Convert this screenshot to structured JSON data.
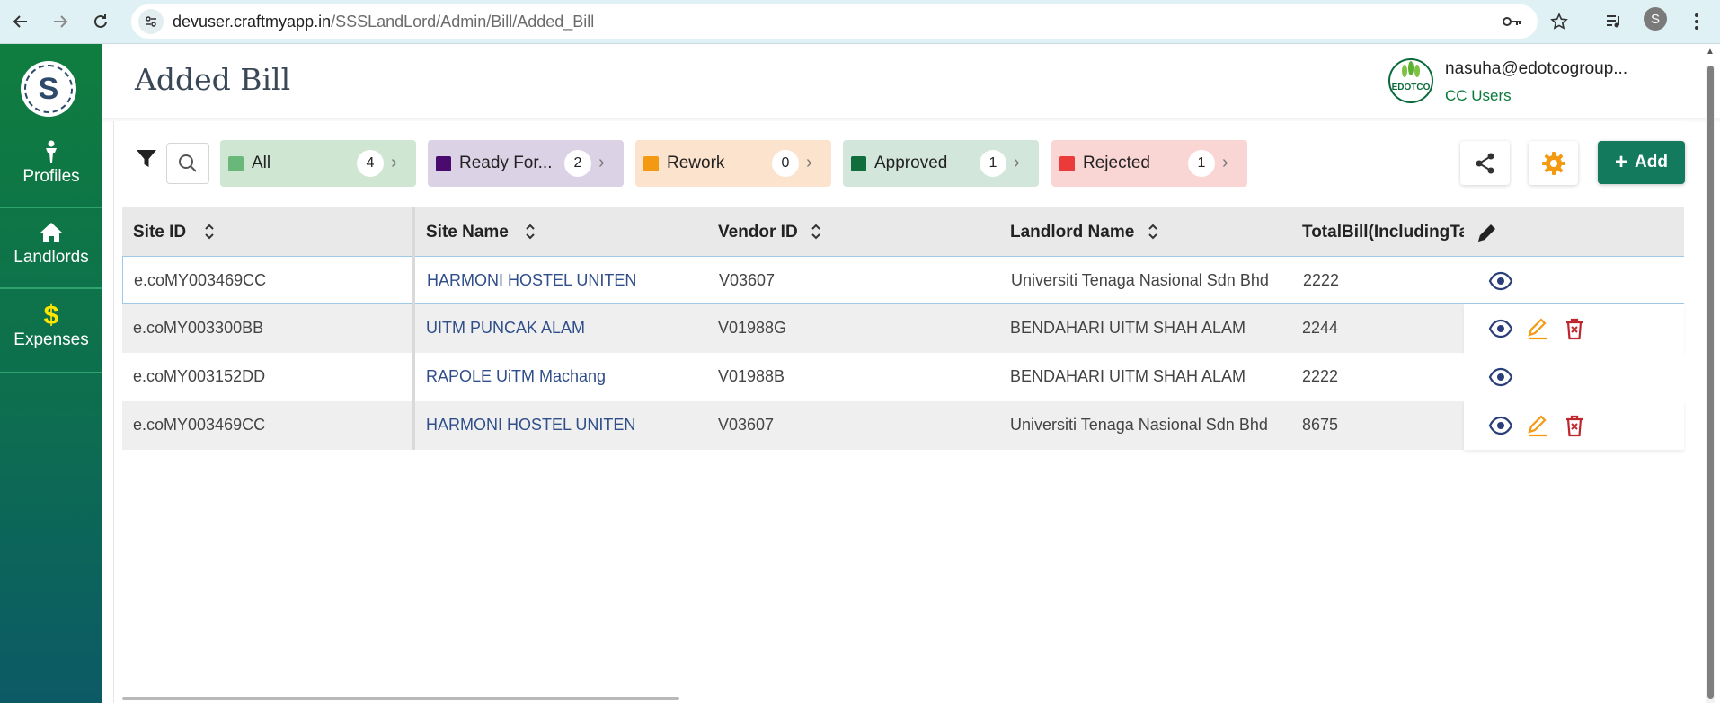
{
  "browser": {
    "url_domain": "devuser.craftmyapp.in",
    "url_path": "/SSSLandLord/Admin/Bill/Added_Bill",
    "profile_initial": "S"
  },
  "sidebar": {
    "logo_letter": "S",
    "items": [
      {
        "label": "Profiles",
        "icon": "person-icon"
      },
      {
        "label": "Landlords",
        "icon": "home-icon"
      },
      {
        "label": "Expenses",
        "icon": "dollar-icon"
      }
    ]
  },
  "header": {
    "title": "Added Bill",
    "user_email": "nasuha@edotcogroup...",
    "user_role": "CC Users",
    "user_logo_text": "EDOTCO"
  },
  "filters": [
    {
      "label": "All",
      "count": "4",
      "color": "#6ab77a",
      "bg": "#cfe6d3"
    },
    {
      "label": "Ready For...",
      "count": "2",
      "color": "#4a0a6e",
      "bg": "#dcd2e6"
    },
    {
      "label": "Rework",
      "count": "0",
      "color": "#f39a12",
      "bg": "#fbe3cd"
    },
    {
      "label": "Approved",
      "count": "1",
      "color": "#0f6e3b",
      "bg": "#d2e6dc"
    },
    {
      "label": "Rejected",
      "count": "1",
      "color": "#ea3a3a",
      "bg": "#f9d5d3"
    }
  ],
  "toolbar": {
    "add_label": "Add"
  },
  "table": {
    "columns": [
      "Site ID",
      "Site Name",
      "Vendor ID",
      "Landlord Name",
      "TotalBill(IncludingTa"
    ],
    "rows": [
      {
        "site_id": "e.coMY003469CC",
        "site_name": "HARMONI HOSTEL UNITEN",
        "vendor_id": "V03607",
        "landlord": "Universiti Tenaga Nasional Sdn Bhd",
        "total": "2222",
        "editable": false
      },
      {
        "site_id": "e.coMY003300BB",
        "site_name": "UITM PUNCAK ALAM",
        "vendor_id": "V01988G",
        "landlord": "BENDAHARI UITM SHAH ALAM",
        "total": "2244",
        "editable": true
      },
      {
        "site_id": "e.coMY003152DD",
        "site_name": "RAPOLE UiTM Machang",
        "vendor_id": "V01988B",
        "landlord": "BENDAHARI UITM SHAH ALAM",
        "total": "2222",
        "editable": false
      },
      {
        "site_id": "e.coMY003469CC",
        "site_name": "HARMONI HOSTEL UNITEN",
        "vendor_id": "V03607",
        "landlord": "Universiti Tenaga Nasional Sdn Bhd",
        "total": "8675",
        "editable": true
      }
    ]
  },
  "colors": {
    "sidebar_top": "#0f7d3f",
    "sidebar_bottom": "#0c5a66",
    "add_button": "#137a5e",
    "link": "#2f4e8a",
    "gear": "#f39a12",
    "edit": "#f39a12",
    "delete": "#c0262d",
    "view": "#2a3f7a"
  }
}
